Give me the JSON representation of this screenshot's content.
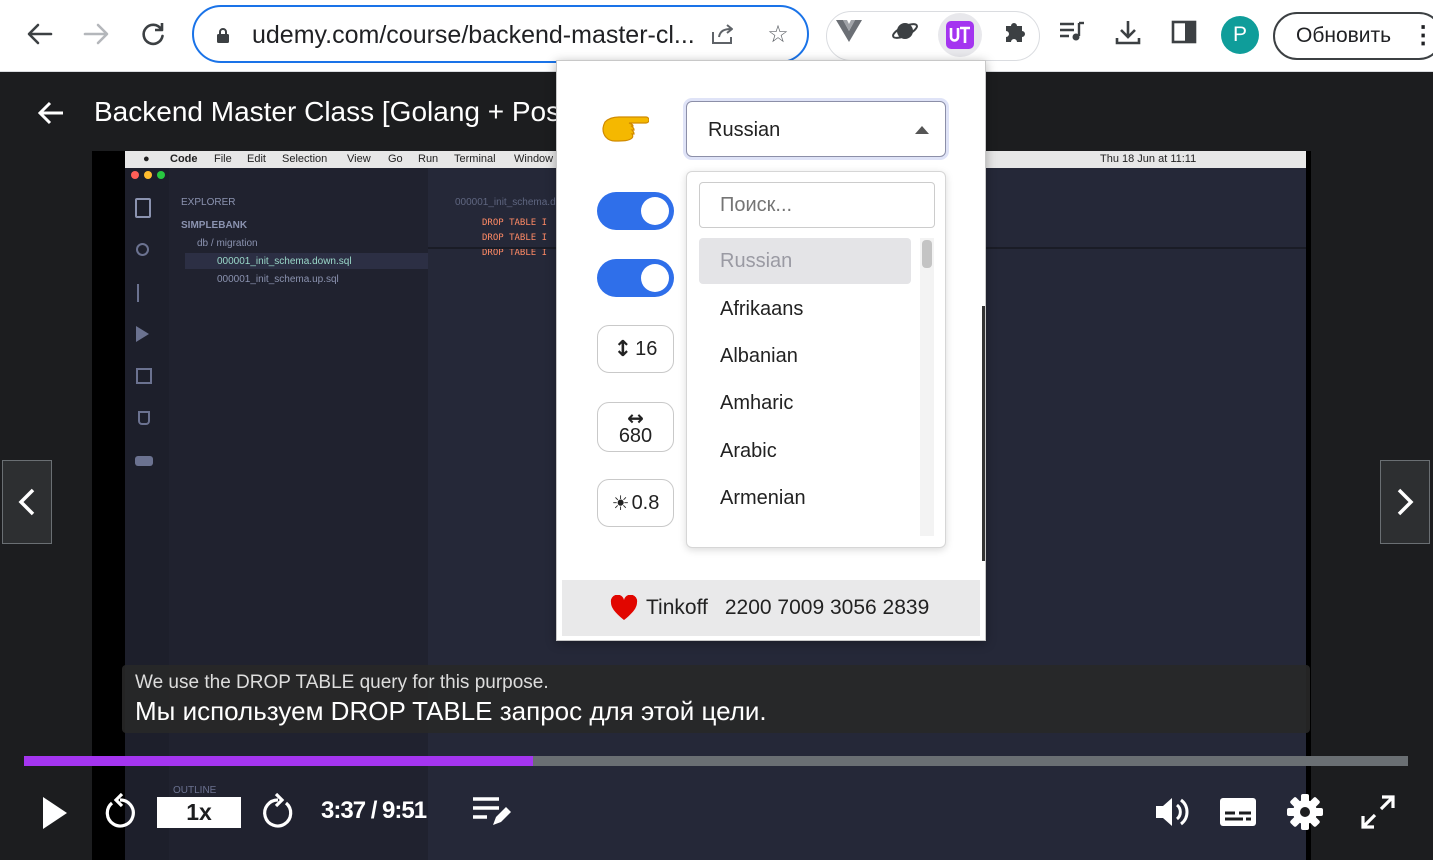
{
  "browser": {
    "url": "udemy.com/course/backend-master-cl...",
    "profile_initial": "P",
    "update_label": "Обновить"
  },
  "course": {
    "title": "Backend Master Class [Golang + Post"
  },
  "vscode": {
    "menu": [
      "Code",
      "File",
      "Edit",
      "Selection",
      "View",
      "Go",
      "Run",
      "Terminal",
      "Window"
    ],
    "clock": "Thu 18 Jun at 11:11",
    "explorer_label": "EXPLORER",
    "project": "SIMPLEBANK",
    "folder": "db / migration",
    "files": [
      "000001_init_schema.down.sql",
      "000001_init_schema.up.sql"
    ],
    "tab": "000001_init_schema.d",
    "code_lines": [
      "DROP TABLE I",
      "DROP TABLE I",
      "DROP TABLE I"
    ],
    "outline_label": "OUTLINE"
  },
  "popup": {
    "selected_language": "Russian",
    "search_placeholder": "Поиск...",
    "languages": [
      "Russian",
      "Afrikaans",
      "Albanian",
      "Amharic",
      "Arabic",
      "Armenian"
    ],
    "font_size": "16",
    "width": "680",
    "brightness": "0.8",
    "toggle1_on": true,
    "toggle2_on": true,
    "donate_bank": "Tinkoff",
    "donate_card": "2200 7009 3056 2839"
  },
  "subtitles": {
    "original": "We use the DROP TABLE query for this purpose.",
    "translated": "Мы используем DROP TABLE запрос для этой цели."
  },
  "player": {
    "speed": "1x",
    "time": "3:37 / 9:51",
    "progress_fraction": 0.368
  },
  "colors": {
    "accent": "#a435f0",
    "toggle": "#2f6fea",
    "chrome_focus": "#1a73e8"
  }
}
